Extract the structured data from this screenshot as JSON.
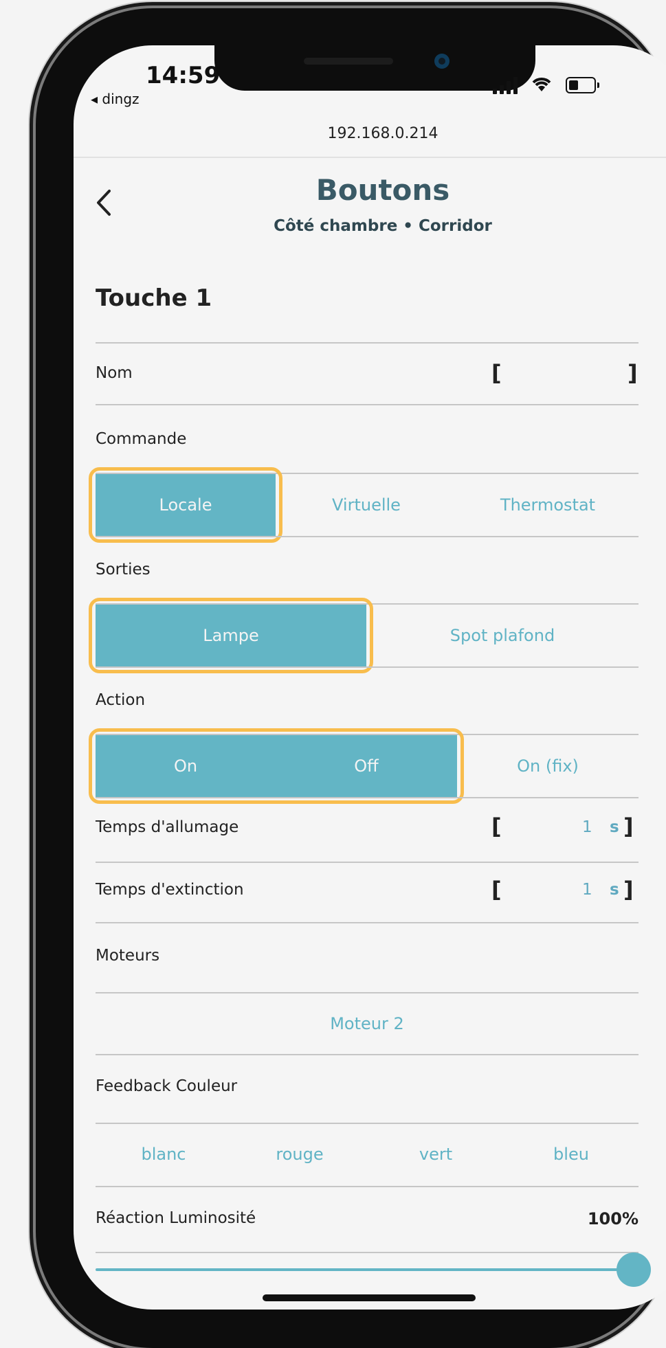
{
  "status_bar": {
    "time": "14:59",
    "back_app": "◂ dingz"
  },
  "browser": {
    "url": "192.168.0.214"
  },
  "header": {
    "back_icon": "chevron-left-icon",
    "title": "Boutons",
    "subtitle": "Côté chambre • Corridor"
  },
  "section": {
    "title": "Touche 1"
  },
  "nom": {
    "label": "Nom",
    "bracket_open": "[",
    "bracket_close": "]",
    "value": ""
  },
  "commande": {
    "label": "Commande",
    "options": [
      "Locale",
      "Virtuelle",
      "Thermostat"
    ],
    "selected": "Locale"
  },
  "sorties": {
    "label": "Sorties",
    "options": [
      "Lampe",
      "Spot plafond"
    ],
    "selected": "Lampe"
  },
  "action": {
    "label": "Action",
    "options": [
      "On",
      "Off",
      "On (fix)"
    ],
    "selected": [
      "On",
      "Off"
    ]
  },
  "temps_allumage": {
    "label": "Temps d'allumage",
    "bracket_open": "[",
    "bracket_close": "]",
    "value": "1",
    "unit": "s"
  },
  "temps_extinction": {
    "label": "Temps d'extinction",
    "bracket_open": "[",
    "bracket_close": "]",
    "value": "1",
    "unit": "s"
  },
  "moteurs": {
    "label": "Moteurs",
    "option": "Moteur 2"
  },
  "feedback": {
    "label": "Feedback Couleur",
    "options": [
      "blanc",
      "rouge",
      "vert",
      "bleu"
    ]
  },
  "luminosite": {
    "label": "Réaction Luminosité",
    "value": "100%",
    "level": 1.0
  },
  "colors": {
    "accent": "#63b5c5",
    "highlight": "#f8bd4d",
    "title": "#3a5a66"
  }
}
